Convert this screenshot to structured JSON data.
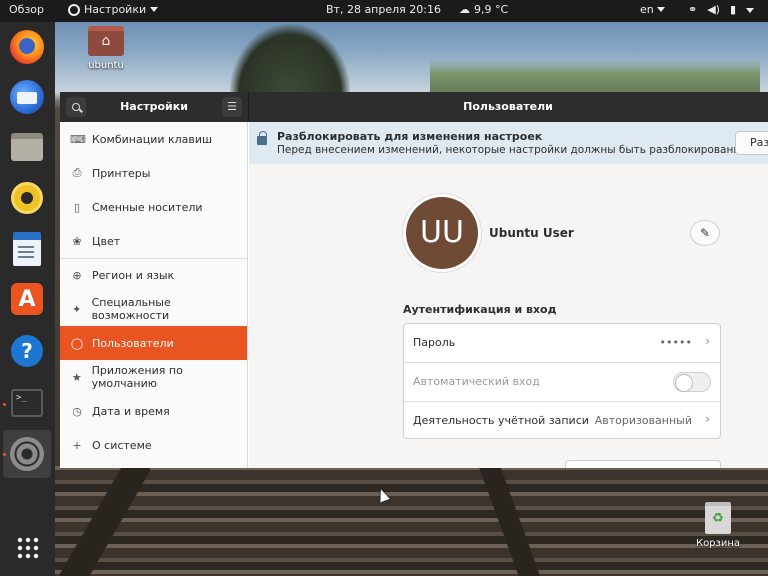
{
  "topbar": {
    "activities": "Обзор",
    "app_menu": "Настройки",
    "clock": "Вт, 28 апреля  20:16",
    "weather": "9,9 °C",
    "language": "en",
    "network_icon": "network-icon",
    "volume_icon": "volume-icon",
    "battery_icon": "battery-icon",
    "menu_icon": "system-menu-icon"
  },
  "dock": {
    "items": [
      {
        "name": "Firefox",
        "icon": "firefox-icon"
      },
      {
        "name": "Thunderbird",
        "icon": "mail-icon"
      },
      {
        "name": "Файлы",
        "icon": "files-icon"
      },
      {
        "name": "Rhythmbox",
        "icon": "rhythmbox-icon"
      },
      {
        "name": "LibreOffice Writer",
        "icon": "writer-icon"
      },
      {
        "name": "Ubuntu Software",
        "icon": "store-icon",
        "glyph": "A"
      },
      {
        "name": "Справка",
        "icon": "help-icon",
        "glyph": "?"
      },
      {
        "name": "Терминал",
        "icon": "terminal-icon",
        "glyph": ">_"
      },
      {
        "name": "Настройки",
        "icon": "settings-icon"
      }
    ],
    "show_apps_icon": "app-grid-icon"
  },
  "desktop": {
    "home_label": "ubuntu",
    "trash_label": "Корзина"
  },
  "window": {
    "sidebar_title": "Настройки",
    "main_title": "Пользователи",
    "sidebar_items": [
      {
        "label": "Комбинации клавиш",
        "icon": "keyboard-icon",
        "glyph": "⌨"
      },
      {
        "label": "Принтеры",
        "icon": "printer-icon",
        "glyph": "⎙"
      },
      {
        "label": "Сменные носители",
        "icon": "removable-media-icon",
        "glyph": "▯"
      },
      {
        "label": "Цвет",
        "icon": "color-icon",
        "glyph": "❀"
      },
      {
        "label": "Регион и язык",
        "icon": "globe-icon",
        "glyph": "⊕"
      },
      {
        "label": "Специальные возможности",
        "icon": "accessibility-icon",
        "glyph": "✦"
      },
      {
        "label": "Пользователи",
        "icon": "user-icon",
        "glyph": "◯",
        "active": true
      },
      {
        "label": "Приложения по умолчанию",
        "icon": "star-icon",
        "glyph": "★"
      },
      {
        "label": "Дата и время",
        "icon": "clock-icon",
        "glyph": "◷"
      },
      {
        "label": "О системе",
        "icon": "info-icon",
        "glyph": "+"
      }
    ],
    "banner": {
      "title": "Разблокировать для изменения настроек",
      "text": "Перед внесением изменений, некоторые настройки должны быть разблокированы",
      "unlock_label": "Разблокировать"
    },
    "user": {
      "initials": "UU",
      "name": "Ubuntu User"
    },
    "auth": {
      "section_title": "Аутентификация и вход",
      "password_label": "Пароль",
      "password_value": "•••••",
      "autologin_label": "Автоматический вход",
      "autologin_enabled": false,
      "activity_label": "Деятельность учётной записи",
      "activity_value": "Авторизованный"
    },
    "colors": {
      "accent": "#e95420",
      "titlebar": "#2d2d2d",
      "banner": "#dfe9f2",
      "avatar": "#6f4a35"
    }
  }
}
